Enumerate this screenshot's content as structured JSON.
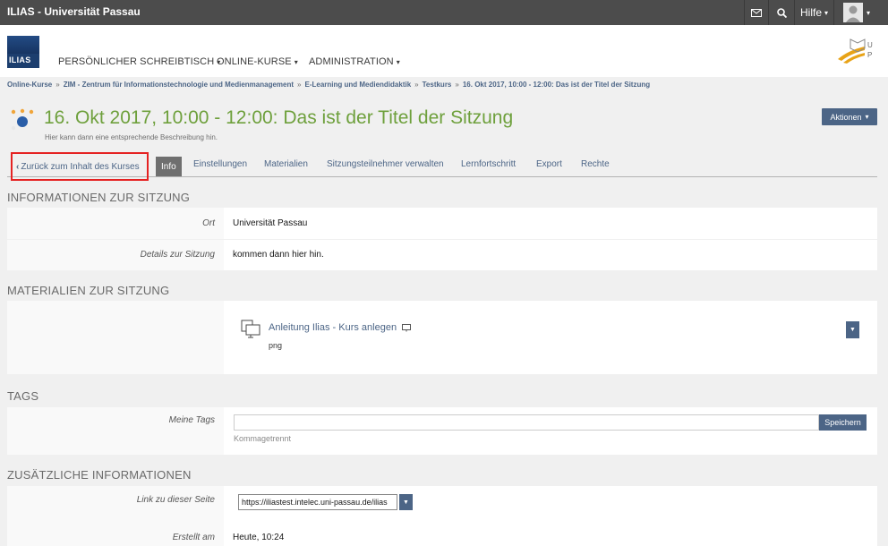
{
  "topbar": {
    "title": "ILIAS - Universität Passau",
    "help": "Hilfe",
    "icons": [
      "mail-icon",
      "search-icon",
      "user-avatar-icon"
    ]
  },
  "logo": {
    "text": "ILIAS"
  },
  "mainnav": {
    "items": [
      {
        "label": "PERSÖNLICHER SCHREIBTISCH"
      },
      {
        "label": "ONLINE-KURSE"
      },
      {
        "label": "ADMINISTRATION"
      }
    ],
    "caret": "▾"
  },
  "uplogo": {
    "letters": [
      "U",
      "P"
    ]
  },
  "breadcrumb": {
    "items": [
      "Online-Kurse",
      "ZIM - Zentrum für Informationstechnologie und Medienmanagement",
      "E-Learning und Mediendidaktik",
      "Testkurs",
      "16. Okt 2017, 10:00 - 12:00: Das ist der Titel der Sitzung"
    ],
    "separator": "»"
  },
  "page": {
    "title": "16. Okt 2017, 10:00 - 12:00: Das ist der Titel der Sitzung",
    "description": "Hier kann dann eine entsprechende Beschreibung hin.",
    "actions_label": "Aktionen"
  },
  "tabs": {
    "back": "Zurück zum Inhalt des Kurses",
    "items": [
      {
        "label": "Info",
        "active": true
      },
      {
        "label": "Einstellungen"
      },
      {
        "label": "Materialien"
      },
      {
        "label": "Sitzungsteilnehmer verwalten"
      },
      {
        "label": "Lernfortschritt"
      },
      {
        "label": "Export"
      },
      {
        "label": "Rechte"
      }
    ]
  },
  "sections": {
    "info": {
      "title": "INFORMATIONEN ZUR SITZUNG",
      "rows": [
        {
          "label": "Ort",
          "value": "Universität Passau"
        },
        {
          "label": "Details zur Sitzung",
          "value": "kommen dann hier hin."
        }
      ]
    },
    "materials": {
      "title": "MATERIALIEN ZUR SITZUNG",
      "item_title": "Anleitung Ilias - Kurs anlegen",
      "item_type": "png"
    },
    "tags": {
      "title": "TAGS",
      "label": "Meine Tags",
      "input_value": "",
      "hint": "Kommagetrennt",
      "save": "Speichern"
    },
    "extra": {
      "title": "ZUSÄTZLICHE INFORMATIONEN",
      "link_label": "Link zu dieser Seite",
      "link_value": "https://iliastest.intelec.uni-passau.de/ilias",
      "created_label": "Erstellt am",
      "created_value": "Heute, 10:24"
    }
  },
  "colors": {
    "topbar": "#4c4c4c",
    "accent": "#4c6586",
    "title_green": "#6ea03c",
    "highlight_red": "#e52222"
  }
}
